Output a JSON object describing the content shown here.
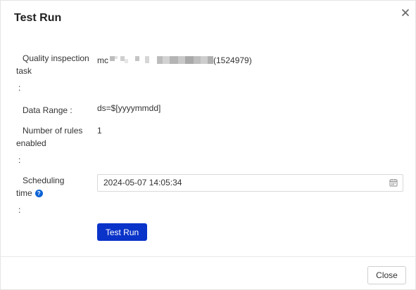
{
  "dialog": {
    "title": "Test Run",
    "close_icon": "close-icon"
  },
  "fields": {
    "task": {
      "label_line1": "Quality inspection",
      "label_line2": "task",
      "colon": ":",
      "value_prefix": "mc",
      "value_suffix": "(1524979)"
    },
    "data_range": {
      "label": "Data Range :",
      "value": "ds=$[yyyymmdd]"
    },
    "rules": {
      "label_line1": "Number of rules",
      "label_line2": "enabled",
      "colon": ":",
      "value": "1"
    },
    "scheduling": {
      "label_line1": "Scheduling",
      "label_line2": "time",
      "help_icon": "question-circle-icon",
      "help_glyph": "?",
      "colon": ":",
      "value": "2024-05-07 14:05:34",
      "calendar_icon": "calendar-icon"
    }
  },
  "actions": {
    "test_run_label": "Test Run",
    "close_label": "Close"
  },
  "colors": {
    "primary": "#0a33c9",
    "help": "#0b63d6"
  }
}
